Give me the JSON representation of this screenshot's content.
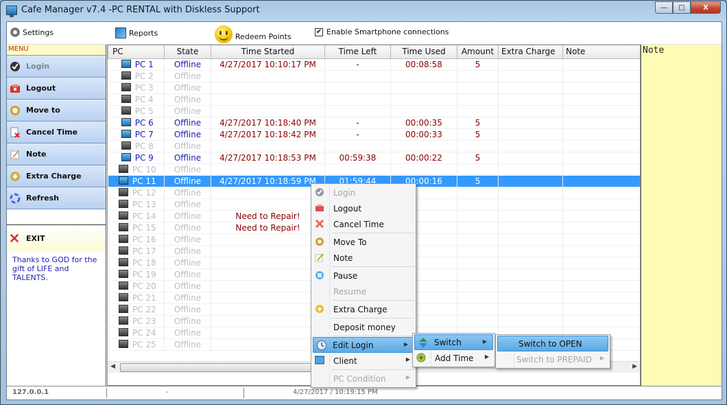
{
  "window": {
    "title": "Cafe Manager v7.4 -PC RENTAL with  Diskless Support",
    "minimize_label": "—",
    "maximize_label": "□",
    "close_label": "X"
  },
  "toolbar": {
    "settings_label": "Settings",
    "reports_label": "Reports",
    "redeem_label": "Redeem Points",
    "smartphone_label": "Enable Smartphone connections",
    "smartphone_checked": "✔"
  },
  "menu": {
    "header": "MENU",
    "items": [
      {
        "label": "Login",
        "icon": "check-icon",
        "disabled": true
      },
      {
        "label": "Logout",
        "icon": "logout-icon",
        "disabled": false
      },
      {
        "label": "Move to",
        "icon": "move-icon",
        "disabled": false
      },
      {
        "label": "Cancel Time",
        "icon": "cancel-icon",
        "disabled": false
      },
      {
        "label": "Note",
        "icon": "note-icon",
        "disabled": false
      },
      {
        "label": "Extra Charge",
        "icon": "plus-icon",
        "disabled": false
      },
      {
        "label": "Refresh",
        "icon": "refresh-icon",
        "disabled": false
      }
    ],
    "exit_label": "EXIT",
    "thanks_text": "Thanks to GOD for the gift of  LIFE and TALENTS."
  },
  "grid": {
    "columns": [
      "PC",
      "State",
      "Time Started",
      "Time Left",
      "Time Used",
      "Amount",
      "Extra Charge",
      "Note"
    ],
    "rows": [
      {
        "pc": "PC 1",
        "state": "Offline",
        "started": "4/27/2017 10:10:17 PM",
        "left": "-",
        "used": "00:08:58",
        "amount": "5",
        "extra": "",
        "note": "",
        "active": true
      },
      {
        "pc": "PC 2",
        "state": "Offline",
        "started": "",
        "left": "",
        "used": "",
        "amount": "",
        "extra": "",
        "note": "",
        "active": false
      },
      {
        "pc": "PC 3",
        "state": "Offline",
        "started": "",
        "left": "",
        "used": "",
        "amount": "",
        "extra": "",
        "note": "",
        "active": false
      },
      {
        "pc": "PC 4",
        "state": "Offline",
        "started": "",
        "left": "",
        "used": "",
        "amount": "",
        "extra": "",
        "note": "",
        "active": false
      },
      {
        "pc": "PC 5",
        "state": "Offline",
        "started": "",
        "left": "",
        "used": "",
        "amount": "",
        "extra": "",
        "note": "",
        "active": false
      },
      {
        "pc": "PC 6",
        "state": "Offline",
        "started": "4/27/2017 10:18:40 PM",
        "left": "-",
        "used": "00:00:35",
        "amount": "5",
        "extra": "",
        "note": "",
        "active": true
      },
      {
        "pc": "PC 7",
        "state": "Offline",
        "started": "4/27/2017 10:18:42 PM",
        "left": "-",
        "used": "00:00:33",
        "amount": "5",
        "extra": "",
        "note": "",
        "active": true
      },
      {
        "pc": "PC 8",
        "state": "Offline",
        "started": "",
        "left": "",
        "used": "",
        "amount": "",
        "extra": "",
        "note": "",
        "active": false
      },
      {
        "pc": "PC 9",
        "state": "Offline",
        "started": "4/27/2017 10:18:53 PM",
        "left": "00:59:38",
        "used": "00:00:22",
        "amount": "5",
        "extra": "",
        "note": "",
        "active": true
      },
      {
        "pc": "PC 10",
        "state": "Offline",
        "started": "",
        "left": "",
        "used": "",
        "amount": "",
        "extra": "",
        "note": "",
        "active": false
      },
      {
        "pc": "PC 11",
        "state": "Offline",
        "started": "4/27/2017 10:18:59 PM",
        "left": "01:59:44",
        "used": "00:00:16",
        "amount": "5",
        "extra": "",
        "note": "",
        "active": true,
        "selected": true
      },
      {
        "pc": "PC 12",
        "state": "Offline",
        "started": "",
        "left": "",
        "used": "",
        "amount": "",
        "extra": "",
        "note": "",
        "active": false
      },
      {
        "pc": "PC 13",
        "state": "Offline",
        "started": "",
        "left": "",
        "used": "",
        "amount": "",
        "extra": "",
        "note": "",
        "active": false
      },
      {
        "pc": "PC 14",
        "state": "Offline",
        "started": "Need to Repair!",
        "left": "",
        "used": "",
        "amount": "",
        "extra": "",
        "note": "",
        "active": false
      },
      {
        "pc": "PC 15",
        "state": "Offline",
        "started": "Need to Repair!",
        "left": "",
        "used": "",
        "amount": "",
        "extra": "",
        "note": "",
        "active": false
      },
      {
        "pc": "PC 16",
        "state": "Offline",
        "started": "",
        "left": "",
        "used": "",
        "amount": "",
        "extra": "",
        "note": "",
        "active": false
      },
      {
        "pc": "PC 17",
        "state": "Offline",
        "started": "",
        "left": "",
        "used": "",
        "amount": "",
        "extra": "",
        "note": "",
        "active": false
      },
      {
        "pc": "PC 18",
        "state": "Offline",
        "started": "",
        "left": "",
        "used": "",
        "amount": "",
        "extra": "",
        "note": "",
        "active": false
      },
      {
        "pc": "PC 19",
        "state": "Offline",
        "started": "",
        "left": "",
        "used": "",
        "amount": "",
        "extra": "",
        "note": "",
        "active": false
      },
      {
        "pc": "PC 20",
        "state": "Offline",
        "started": "",
        "left": "",
        "used": "",
        "amount": "",
        "extra": "",
        "note": "",
        "active": false
      },
      {
        "pc": "PC 21",
        "state": "Offline",
        "started": "",
        "left": "",
        "used": "",
        "amount": "",
        "extra": "",
        "note": "",
        "active": false
      },
      {
        "pc": "PC 22",
        "state": "Offline",
        "started": "",
        "left": "",
        "used": "",
        "amount": "",
        "extra": "",
        "note": "",
        "active": false
      },
      {
        "pc": "PC 23",
        "state": "Offline",
        "started": "",
        "left": "",
        "used": "",
        "amount": "",
        "extra": "",
        "note": "",
        "active": false
      },
      {
        "pc": "PC 24",
        "state": "Offline",
        "started": "",
        "left": "",
        "used": "",
        "amount": "",
        "extra": "",
        "note": "",
        "active": false
      },
      {
        "pc": "PC 25",
        "state": "Offline",
        "started": "",
        "left": "",
        "used": "",
        "amount": "",
        "extra": "",
        "note": "",
        "active": false
      }
    ]
  },
  "note_panel": {
    "title": "Note"
  },
  "statusbar": {
    "ip": "127.0.0.1",
    "middle": "-",
    "datetime": "4/27/2017 / 10:19:15 PM"
  },
  "context_menu": {
    "items": [
      {
        "label": "Login",
        "icon": "check-icon",
        "disabled": true
      },
      {
        "label": "Logout",
        "icon": "logout-icon"
      },
      {
        "label": "Cancel Time",
        "icon": "cancel-icon",
        "sep_after": true
      },
      {
        "label": "Move To",
        "icon": "move-icon"
      },
      {
        "label": "Note",
        "icon": "note-icon",
        "sep_after": true
      },
      {
        "label": "Pause",
        "icon": "pause-icon"
      },
      {
        "label": "Resume",
        "icon": "",
        "disabled": true,
        "sep_after": true
      },
      {
        "label": "Extra Charge",
        "icon": "plus-icon",
        "sep_after": true
      },
      {
        "label": "Deposit money",
        "icon": "",
        "sep_after": true
      },
      {
        "label": "Edit Login",
        "icon": "clock-icon",
        "submenu": true,
        "highlighted": true
      },
      {
        "label": "Client",
        "icon": "monitor-icon",
        "submenu": true,
        "sep_after": true
      },
      {
        "label": "PC Condition",
        "icon": "",
        "submenu": true,
        "disabled": true
      }
    ]
  },
  "edit_login_submenu": {
    "items": [
      {
        "label": "Switch",
        "icon": "switch-icon",
        "submenu": true,
        "highlighted": true
      },
      {
        "label": "Add Time",
        "icon": "add-time-icon",
        "submenu": true
      }
    ]
  },
  "switch_submenu": {
    "items": [
      {
        "label": "Switch to OPEN",
        "highlighted": true
      },
      {
        "label": "Switch to PREPAID",
        "disabled": true,
        "submenu": true
      }
    ]
  }
}
